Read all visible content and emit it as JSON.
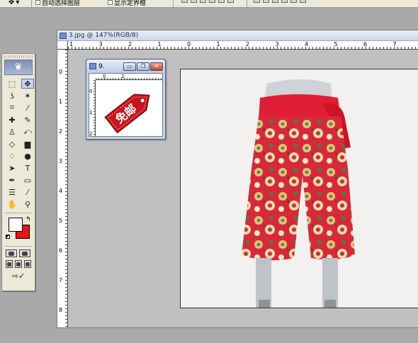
{
  "options_bar": {
    "auto_select_label": "自动选择图层",
    "show_transform_label": "显示定界框",
    "move_tool_glyph": "✥"
  },
  "toolbox": {
    "tools": [
      {
        "name": "marquee-tool",
        "glyph": "⬚",
        "active": false
      },
      {
        "name": "move-tool",
        "glyph": "✥",
        "active": true
      },
      {
        "name": "lasso-tool",
        "glyph": "ʖ",
        "active": false
      },
      {
        "name": "magic-wand-tool",
        "glyph": "✶",
        "active": false
      },
      {
        "name": "crop-tool",
        "glyph": "⌗",
        "active": false
      },
      {
        "name": "slice-tool",
        "glyph": "⁄",
        "active": false
      },
      {
        "name": "healing-brush-tool",
        "glyph": "✚",
        "active": false
      },
      {
        "name": "brush-tool",
        "glyph": "✎",
        "active": false
      },
      {
        "name": "clone-stamp-tool",
        "glyph": "♙",
        "active": false
      },
      {
        "name": "history-brush-tool",
        "glyph": "⤺",
        "active": false
      },
      {
        "name": "eraser-tool",
        "glyph": "◇",
        "active": false
      },
      {
        "name": "gradient-tool",
        "glyph": "▆",
        "active": false
      },
      {
        "name": "blur-tool",
        "glyph": "♢",
        "active": false
      },
      {
        "name": "dodge-tool",
        "glyph": "●",
        "active": false
      },
      {
        "name": "path-selection-tool",
        "glyph": "➤",
        "active": false
      },
      {
        "name": "type-tool",
        "glyph": "T",
        "active": false
      },
      {
        "name": "pen-tool",
        "glyph": "✒",
        "active": false
      },
      {
        "name": "shape-tool",
        "glyph": "▭",
        "active": false
      },
      {
        "name": "notes-tool",
        "glyph": "☰",
        "active": false
      },
      {
        "name": "eyedropper-tool",
        "glyph": "⁄",
        "active": false
      },
      {
        "name": "hand-tool",
        "glyph": "✋",
        "active": false
      },
      {
        "name": "zoom-tool",
        "glyph": "⚲",
        "active": false
      }
    ],
    "foreground_color": "#ffffff",
    "background_color": "#e8141b",
    "swap_glyph": "↰"
  },
  "document": {
    "title": "3.jpg @ 147%(RGB/8)",
    "ruler_h_labels": [
      "1",
      "3",
      "2",
      "1",
      "0",
      "1",
      "2",
      "3",
      "4",
      "5",
      "6",
      "7"
    ],
    "ruler_v_labels": [
      "0",
      "1",
      "2",
      "3",
      "4",
      "5",
      "6",
      "7",
      "8"
    ],
    "photo_description_colors": {
      "skirt": "#d9293a",
      "sash": "#e01e35",
      "background": "#f2f1ef"
    }
  },
  "sub_window": {
    "title": "9.",
    "minimize_glyph": "▭",
    "restore_glyph": "❐",
    "close_glyph": "✕",
    "ruler_h_labels": [
      "0",
      "2"
    ],
    "ruler_v_labels": [
      "0",
      "1",
      "2"
    ],
    "tag_text": "免邮",
    "tag_color": "#c8161d"
  }
}
